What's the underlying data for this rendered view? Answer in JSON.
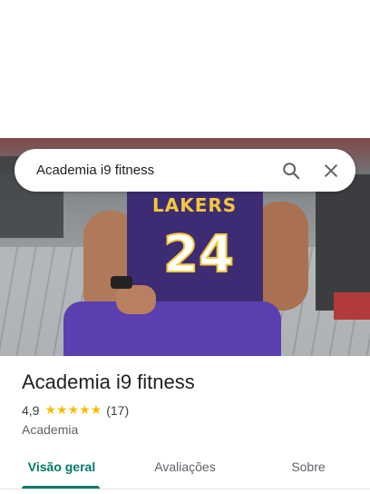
{
  "search": {
    "query": "Academia i9 fitness",
    "search_icon": "search-icon",
    "close_icon": "close-icon"
  },
  "hero": {
    "jersey_text": "LAKERS",
    "jersey_number": "24"
  },
  "place": {
    "name": "Academia i9 fitness",
    "rating": "4,9",
    "stars": "★★★★★",
    "reviews": "(17)",
    "category": "Academia"
  },
  "tabs": [
    {
      "label": "Visão geral",
      "active": true
    },
    {
      "label": "Avaliações",
      "active": false
    },
    {
      "label": "Sobre",
      "active": false
    }
  ],
  "colors": {
    "accent": "#00796b",
    "star": "#fbbc04",
    "text": "#202124"
  }
}
